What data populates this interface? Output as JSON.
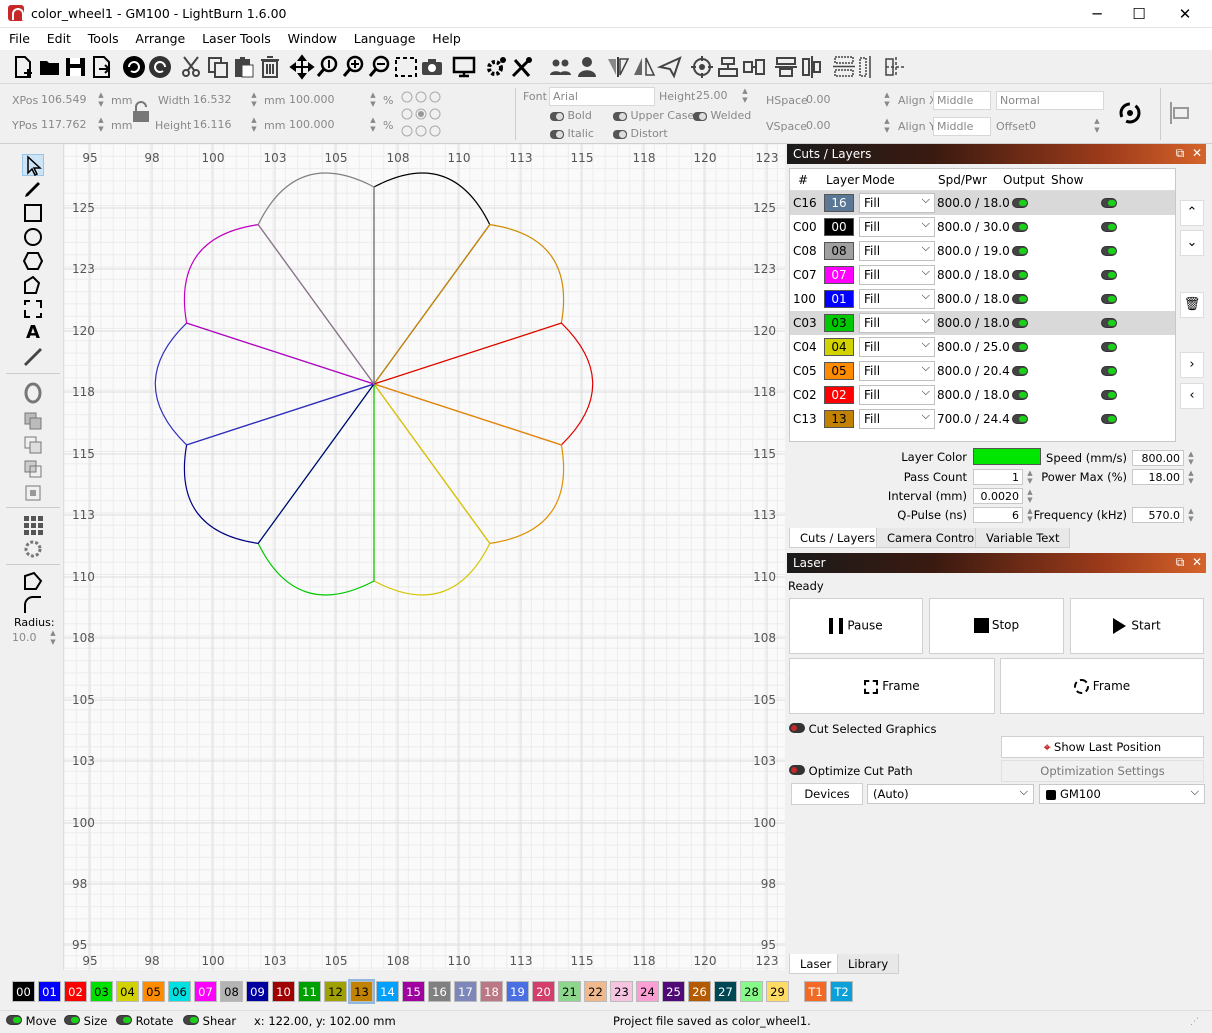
{
  "window": {
    "title": "color_wheel1 - GM100 - LightBurn 1.6.00"
  },
  "menu": [
    "File",
    "Edit",
    "Tools",
    "Arrange",
    "Laser Tools",
    "Window",
    "Language",
    "Help"
  ],
  "props": {
    "xpos_label": "XPos",
    "xpos": "106.549",
    "ypos_label": "YPos",
    "ypos": "117.762",
    "unit": "mm",
    "width_label": "Width",
    "width": "16.532",
    "height_label": "Height",
    "height": "16.116",
    "scale_w": "100.000",
    "scale_h": "100.000",
    "pct": "%",
    "font_label": "Font",
    "font": "Arial",
    "fheight_label": "Height",
    "fheight": "25.00",
    "bold": "Bold",
    "italic": "Italic",
    "upper": "Upper Case",
    "welded": "Welded",
    "distort": "Distort",
    "hspace_label": "HSpace",
    "hspace": "0.00",
    "vspace_label": "VSpace",
    "vspace": "0.00",
    "alignx_label": "Align X",
    "alignx": "Middle",
    "aligny_label": "Align Y",
    "aligny": "Middle",
    "normal": "Normal",
    "offset_label": "Offset",
    "offset": "0"
  },
  "left_tools": {
    "radius_label": "Radius:",
    "radius": "10.0"
  },
  "ruler": {
    "x": [
      "95",
      "98",
      "100",
      "103",
      "105",
      "108",
      "110",
      "113",
      "115",
      "118",
      "120",
      "123"
    ],
    "y": [
      "125",
      "123",
      "120",
      "118",
      "115",
      "113",
      "110",
      "108",
      "105",
      "103",
      "100",
      "98",
      "95"
    ]
  },
  "cuts": {
    "title": "Cuts / Layers",
    "headers": {
      "num": "#",
      "layer": "Layer",
      "mode": "Mode",
      "spdpwr": "Spd/Pwr",
      "output": "Output",
      "show": "Show"
    },
    "rows": [
      {
        "num": "C16",
        "layer": "16",
        "color": "#5a7896",
        "text": "#ffffff",
        "mode": "Fill",
        "spdpwr": "800.0 / 18.0",
        "sel": true
      },
      {
        "num": "C00",
        "layer": "00",
        "color": "#000000",
        "text": "#ffffff",
        "mode": "Fill",
        "spdpwr": "800.0 / 30.0",
        "sel": false
      },
      {
        "num": "C08",
        "layer": "08",
        "color": "#a0a0a0",
        "text": "#000000",
        "mode": "Fill",
        "spdpwr": "800.0 / 19.0",
        "sel": false
      },
      {
        "num": "C07",
        "layer": "07",
        "color": "#ff00ff",
        "text": "#ffffff",
        "mode": "Fill",
        "spdpwr": "800.0 / 18.0",
        "sel": false
      },
      {
        "num": "100",
        "layer": "01",
        "color": "#0000ff",
        "text": "#ffffff",
        "mode": "Fill",
        "spdpwr": "800.0 / 18.0",
        "sel": false
      },
      {
        "num": "C03",
        "layer": "03",
        "color": "#00c800",
        "text": "#000000",
        "mode": "Fill",
        "spdpwr": "800.0 / 18.0",
        "sel": true
      },
      {
        "num": "C04",
        "layer": "04",
        "color": "#d2d200",
        "text": "#000000",
        "mode": "Fill",
        "spdpwr": "800.0 / 25.0",
        "sel": false
      },
      {
        "num": "C05",
        "layer": "05",
        "color": "#ff8c00",
        "text": "#000000",
        "mode": "Fill",
        "spdpwr": "800.0 / 20.4",
        "sel": false
      },
      {
        "num": "C02",
        "layer": "02",
        "color": "#ff0000",
        "text": "#ffffff",
        "mode": "Fill",
        "spdpwr": "800.0 / 18.0",
        "sel": false
      },
      {
        "num": "C13",
        "layer": "13",
        "color": "#c08200",
        "text": "#000000",
        "mode": "Fill",
        "spdpwr": "700.0 / 24.4",
        "sel": false
      }
    ],
    "layer_color_label": "Layer Color",
    "layer_color": "#00e600",
    "pass_count_label": "Pass Count",
    "pass_count": "1",
    "interval_label": "Interval (mm)",
    "interval": "0.0020",
    "qpulse_label": "Q-Pulse (ns)",
    "qpulse": "6",
    "speed_label": "Speed (mm/s)",
    "speed": "800.00",
    "power_label": "Power Max (%)",
    "power": "18.00",
    "freq_label": "Frequency (kHz)",
    "freq": "570.0",
    "tabs": [
      "Cuts / Layers",
      "Camera Control",
      "Variable Text"
    ]
  },
  "laser": {
    "title": "Laser",
    "status": "Ready",
    "pause": "Pause",
    "stop": "Stop",
    "start": "Start",
    "frame1": "Frame",
    "frame2": "Frame",
    "cut_selected": "Cut Selected Graphics",
    "show_last": "Show Last Position",
    "optimize": "Optimize Cut Path",
    "opt_settings": "Optimization Settings",
    "devices": "Devices",
    "auto": "(Auto)",
    "device": "GM100",
    "tabs": [
      "Laser",
      "Library"
    ]
  },
  "palette": [
    {
      "l": "00",
      "c": "#000000",
      "t": "#fff"
    },
    {
      "l": "01",
      "c": "#0000ff",
      "t": "#fff"
    },
    {
      "l": "02",
      "c": "#ff0000",
      "t": "#fff"
    },
    {
      "l": "03",
      "c": "#00e000",
      "t": "#000"
    },
    {
      "l": "04",
      "c": "#d2d200",
      "t": "#000"
    },
    {
      "l": "05",
      "c": "#ff8c00",
      "t": "#000"
    },
    {
      "l": "06",
      "c": "#00e0e0",
      "t": "#000"
    },
    {
      "l": "07",
      "c": "#ff00ff",
      "t": "#fff"
    },
    {
      "l": "08",
      "c": "#b4b4b4",
      "t": "#000"
    },
    {
      "l": "09",
      "c": "#0000a0",
      "t": "#fff"
    },
    {
      "l": "10",
      "c": "#a00000",
      "t": "#fff"
    },
    {
      "l": "11",
      "c": "#00a000",
      "t": "#fff"
    },
    {
      "l": "12",
      "c": "#a0a000",
      "t": "#000"
    },
    {
      "l": "13",
      "c": "#c08200",
      "t": "#000"
    },
    {
      "l": "14",
      "c": "#00a0ff",
      "t": "#fff"
    },
    {
      "l": "15",
      "c": "#a000a0",
      "t": "#fff"
    },
    {
      "l": "16",
      "c": "#808080",
      "t": "#fff"
    },
    {
      "l": "17",
      "c": "#7d87b9",
      "t": "#fff"
    },
    {
      "l": "18",
      "c": "#bb7784",
      "t": "#fff"
    },
    {
      "l": "19",
      "c": "#4a6fe3",
      "t": "#fff"
    },
    {
      "l": "20",
      "c": "#d33f6a",
      "t": "#fff"
    },
    {
      "l": "21",
      "c": "#8cd78c",
      "t": "#000"
    },
    {
      "l": "22",
      "c": "#f0b98d",
      "t": "#000"
    },
    {
      "l": "23",
      "c": "#f6c4e1",
      "t": "#000"
    },
    {
      "l": "24",
      "c": "#fa9ed4",
      "t": "#000"
    },
    {
      "l": "25",
      "c": "#500a78",
      "t": "#fff"
    },
    {
      "l": "26",
      "c": "#b45a00",
      "t": "#fff"
    },
    {
      "l": "27",
      "c": "#004754",
      "t": "#fff"
    },
    {
      "l": "28",
      "c": "#86fa88",
      "t": "#000"
    },
    {
      "l": "29",
      "c": "#ffdb66",
      "t": "#000"
    },
    {
      "l": "T1",
      "c": "#f36926",
      "t": "#fff"
    },
    {
      "l": "T2",
      "c": "#0ca0d9",
      "t": "#fff"
    }
  ],
  "status": {
    "move": "Move",
    "size": "Size",
    "rotate": "Rotate",
    "shear": "Shear",
    "coords": "x: 122.00, y: 102.00 mm",
    "message": "Project file saved as color_wheel1."
  }
}
